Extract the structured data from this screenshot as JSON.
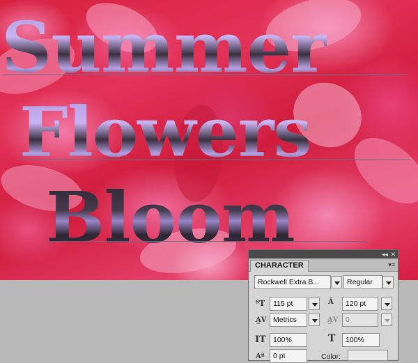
{
  "artwork": {
    "line1": "Summer",
    "line2": "Flowers",
    "line3": "Bloom"
  },
  "panel": {
    "title": "CHARACTER",
    "window_controls": {
      "collapse": "◂◂",
      "close": "✕"
    },
    "font_family": "Rockwell Extra B...",
    "font_style": "Regular",
    "font_size": "115 pt",
    "leading": "120 pt",
    "kerning": "Metrics",
    "tracking": "0",
    "vertical_scale": "100%",
    "horizontal_scale": "100%",
    "baseline_shift": "0 pt",
    "color_label": "Color:"
  },
  "icons": {
    "font_size": "font-size-icon",
    "leading": "leading-icon",
    "kerning": "kerning-icon",
    "tracking": "tracking-icon",
    "vertical_scale": "vertical-scale-icon",
    "horizontal_scale": "horizontal-scale-icon",
    "baseline_shift": "baseline-shift-icon"
  }
}
